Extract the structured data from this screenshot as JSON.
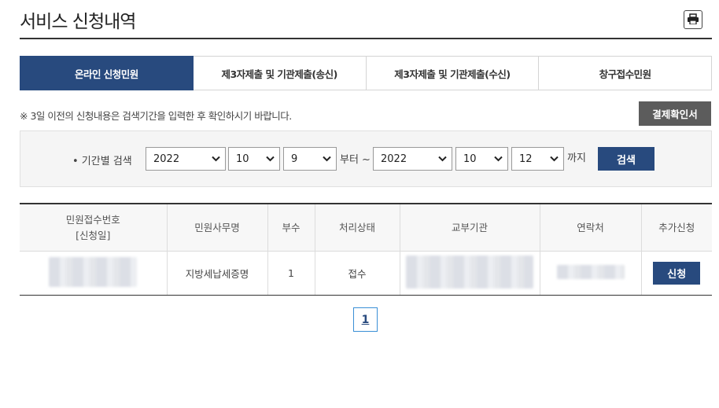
{
  "header": {
    "title": "서비스 신청내역"
  },
  "icons": {
    "print": "printer-icon",
    "dropdown": "chevron-down-icon"
  },
  "tabs": [
    {
      "label": "온라인 신청민원",
      "active": true
    },
    {
      "label": "제3자제출 및 기관제출(송신)",
      "active": false
    },
    {
      "label": "제3자제출 및 기관제출(수신)",
      "active": false
    },
    {
      "label": "창구접수민원",
      "active": false
    }
  ],
  "notice": "※ 3일 이전의 신청내용은 검색기간을 입력한 후 확인하시기 바랍니다.",
  "receipt_button": "결제확인서",
  "search": {
    "label": "• 기간별 검색",
    "from": {
      "year": "2022",
      "month": "10",
      "day": "9"
    },
    "from_suffix": "부터 ~",
    "to": {
      "year": "2022",
      "month": "10",
      "day": "12"
    },
    "to_suffix": "까지",
    "button": "검색"
  },
  "table": {
    "headers": [
      "민원접수번호\n[신청일]",
      "민원사무명",
      "부수",
      "처리상태",
      "교부기관",
      "연락처",
      "추가신청"
    ],
    "rows": [
      {
        "name": "지방세납세증명",
        "copies": "1",
        "status": "접수",
        "action": "신청"
      }
    ]
  },
  "pagination": {
    "current": "1"
  },
  "colors": {
    "primary": "#284a7e",
    "gray_button": "#5c5c5c",
    "pager_border": "#3a8fd6"
  }
}
